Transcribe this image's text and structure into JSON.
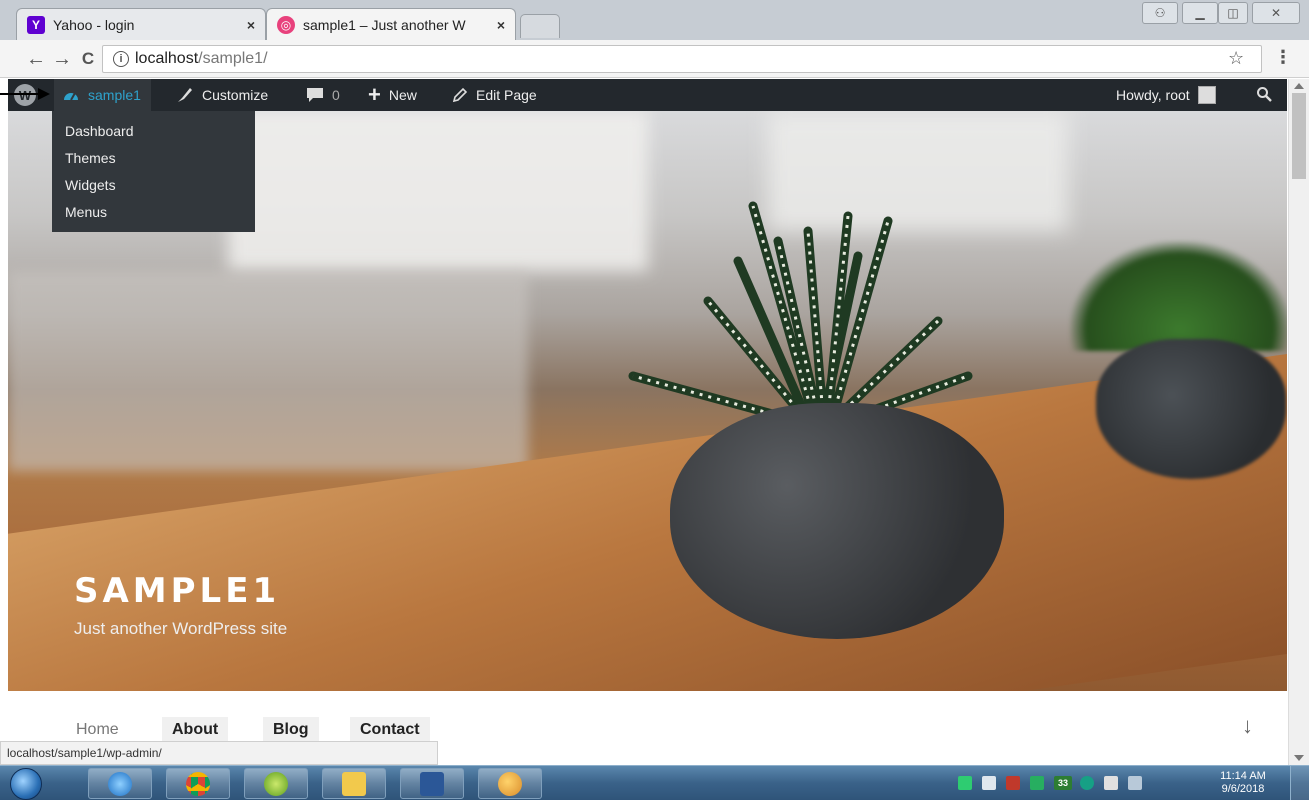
{
  "browser": {
    "tabs": [
      {
        "title": "Yahoo - login",
        "close": "×",
        "icon": "yahoo-icon"
      },
      {
        "title": "sample1 – Just another W",
        "close": "×",
        "icon": "wordpress-site-icon"
      }
    ],
    "address": {
      "info": "i",
      "host": "localhost",
      "path": "/sample1/"
    },
    "nav": {
      "back": "←",
      "forward": "→",
      "reload": "C"
    },
    "star": "☆",
    "menu": "⋮"
  },
  "adminbar": {
    "site_name": "sample1",
    "customize": "Customize",
    "comments_count": "0",
    "new_label": "New",
    "edit_label": "Edit Page",
    "howdy": "Howdy, root"
  },
  "dropdown": {
    "items": [
      "Dashboard",
      "Themes",
      "Widgets",
      "Menus"
    ]
  },
  "hero": {
    "title": "SAMPLE1",
    "tagline": "Just another WordPress site"
  },
  "site_nav": {
    "items": [
      "Home",
      "About",
      "Blog",
      "Contact"
    ],
    "scroll_down": "↓"
  },
  "status_url": "localhost/sample1/wp-admin/",
  "taskbar": {
    "time": "11:14 AM",
    "date": "9/6/2018",
    "tray_number": "33"
  },
  "colors": {
    "admin_bar": "#23282d",
    "admin_bar_active": "#32373c",
    "site_link": "#2ea2cc",
    "taskbar": "#3a6289"
  }
}
